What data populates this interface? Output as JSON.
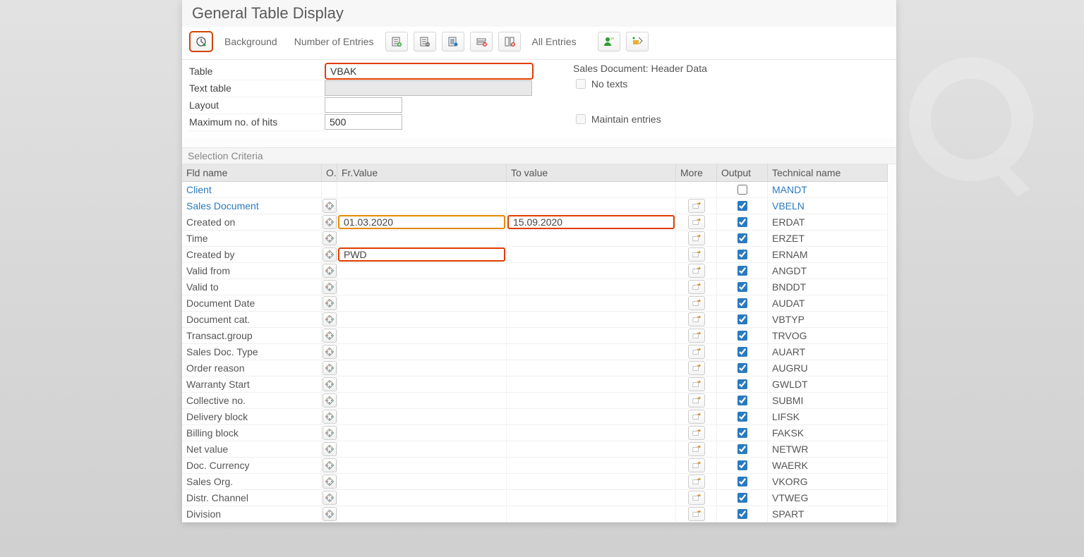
{
  "title": "General Table Display",
  "toolbar": {
    "background": "Background",
    "num_entries": "Number of Entries",
    "all_entries": "All Entries"
  },
  "form": {
    "table_label": "Table",
    "table_value": "VBAK",
    "text_table_label": "Text table",
    "text_table_value": "",
    "layout_label": "Layout",
    "layout_value": "",
    "hits_label": "Maximum no. of hits",
    "hits_value": "500",
    "table_desc": "Sales Document: Header Data",
    "no_texts": "No texts",
    "maintain": "Maintain entries"
  },
  "section": "Selection Criteria",
  "headers": {
    "fld": "Fld name",
    "o": "O.",
    "fr": "Fr.Value",
    "to": "To value",
    "more": "More",
    "out": "Output",
    "tech": "Technical name"
  },
  "rows": [
    {
      "name": "Client",
      "link": true,
      "op": false,
      "fr": "",
      "to": "",
      "more": false,
      "out": false,
      "tech": "MANDT",
      "techlink": true
    },
    {
      "name": "Sales Document",
      "link": true,
      "op": true,
      "fr": "",
      "to": "",
      "more": true,
      "out": true,
      "tech": "VBELN",
      "techlink": true
    },
    {
      "name": "Created on",
      "link": false,
      "op": true,
      "fr": "01.03.2020",
      "to": "15.09.2020",
      "more": true,
      "out": true,
      "tech": "ERDAT",
      "hl_fr": "orange",
      "hl_to": "red"
    },
    {
      "name": "Time",
      "link": false,
      "op": true,
      "fr": "",
      "to": "",
      "more": true,
      "out": true,
      "tech": "ERZET"
    },
    {
      "name": "Created by",
      "link": false,
      "op": true,
      "fr": "PWD",
      "to": "",
      "more": true,
      "out": true,
      "tech": "ERNAM",
      "hl_fr": "red"
    },
    {
      "name": "Valid from",
      "link": false,
      "op": true,
      "fr": "",
      "to": "",
      "more": true,
      "out": true,
      "tech": "ANGDT"
    },
    {
      "name": "Valid to",
      "link": false,
      "op": true,
      "fr": "",
      "to": "",
      "more": true,
      "out": true,
      "tech": "BNDDT"
    },
    {
      "name": "Document Date",
      "link": false,
      "op": true,
      "fr": "",
      "to": "",
      "more": true,
      "out": true,
      "tech": "AUDAT"
    },
    {
      "name": "Document cat.",
      "link": false,
      "op": true,
      "fr": "",
      "to": "",
      "more": true,
      "out": true,
      "tech": "VBTYP"
    },
    {
      "name": "Transact.group",
      "link": false,
      "op": true,
      "fr": "",
      "to": "",
      "more": true,
      "out": true,
      "tech": "TRVOG"
    },
    {
      "name": "Sales Doc. Type",
      "link": false,
      "op": true,
      "fr": "",
      "to": "",
      "more": true,
      "out": true,
      "tech": "AUART"
    },
    {
      "name": "Order reason",
      "link": false,
      "op": true,
      "fr": "",
      "to": "",
      "more": true,
      "out": true,
      "tech": "AUGRU"
    },
    {
      "name": "Warranty Start",
      "link": false,
      "op": true,
      "fr": "",
      "to": "",
      "more": true,
      "out": true,
      "tech": "GWLDT"
    },
    {
      "name": "Collective no.",
      "link": false,
      "op": true,
      "fr": "",
      "to": "",
      "more": true,
      "out": true,
      "tech": "SUBMI"
    },
    {
      "name": "Delivery block",
      "link": false,
      "op": true,
      "fr": "",
      "to": "",
      "more": true,
      "out": true,
      "tech": "LIFSK"
    },
    {
      "name": "Billing block",
      "link": false,
      "op": true,
      "fr": "",
      "to": "",
      "more": true,
      "out": true,
      "tech": "FAKSK"
    },
    {
      "name": "Net value",
      "link": false,
      "op": true,
      "fr": "",
      "to": "",
      "more": true,
      "out": true,
      "tech": "NETWR"
    },
    {
      "name": "Doc. Currency",
      "link": false,
      "op": true,
      "fr": "",
      "to": "",
      "more": true,
      "out": true,
      "tech": "WAERK"
    },
    {
      "name": "Sales Org.",
      "link": false,
      "op": true,
      "fr": "",
      "to": "",
      "more": true,
      "out": true,
      "tech": "VKORG"
    },
    {
      "name": "Distr. Channel",
      "link": false,
      "op": true,
      "fr": "",
      "to": "",
      "more": true,
      "out": true,
      "tech": "VTWEG"
    },
    {
      "name": "Division",
      "link": false,
      "op": true,
      "fr": "",
      "to": "",
      "more": true,
      "out": true,
      "tech": "SPART"
    }
  ]
}
